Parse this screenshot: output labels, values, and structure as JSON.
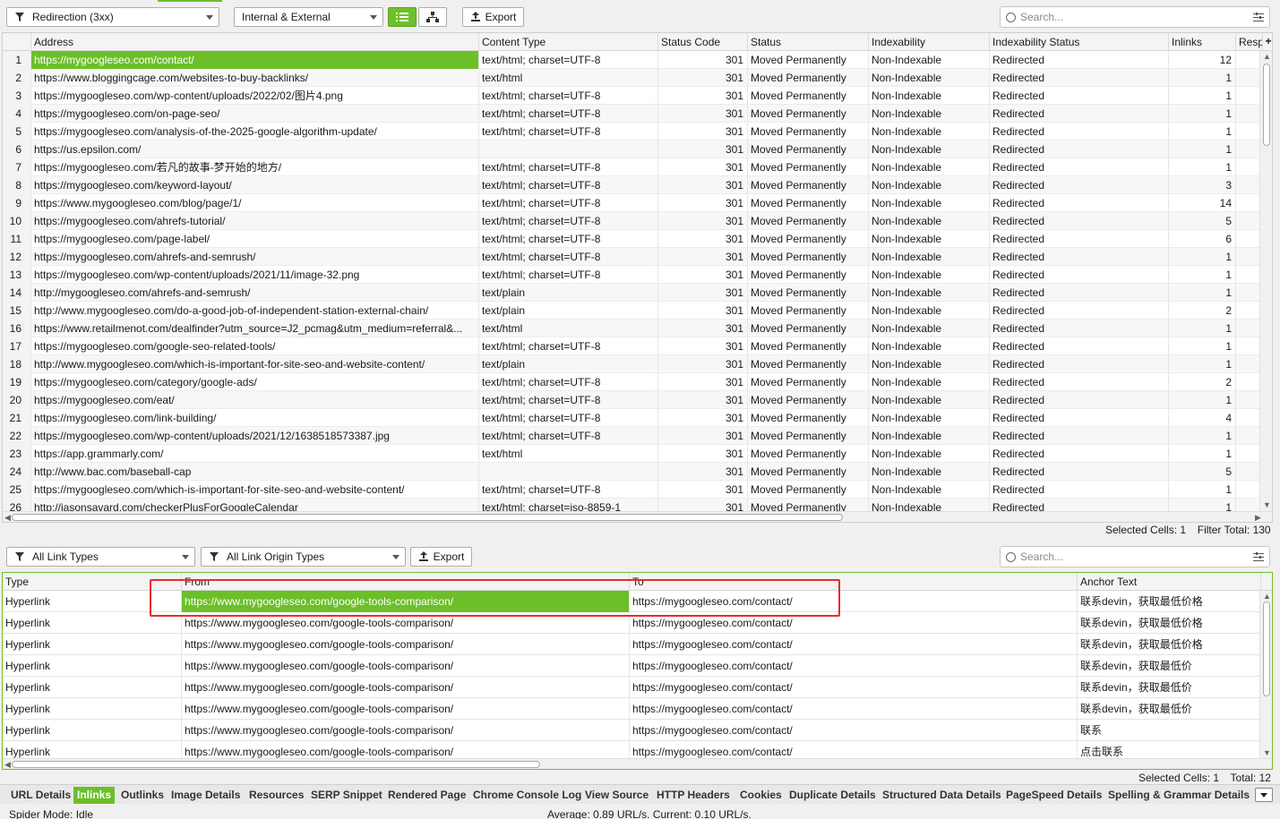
{
  "top_toolbar": {
    "filter": "Redirection (3xx)",
    "scope": "Internal & External",
    "export": "Export",
    "search_placeholder": "Search..."
  },
  "main_grid": {
    "columns": [
      "Address",
      "Content Type",
      "Status Code",
      "Status",
      "Indexability",
      "Indexability Status",
      "Inlinks",
      "Resp"
    ],
    "rows": [
      [
        "1",
        "https://mygoogleseo.com/contact/",
        "text/html; charset=UTF-8",
        "301",
        "Moved Permanently",
        "Non-Indexable",
        "Redirected",
        "12"
      ],
      [
        "2",
        "https://www.bloggingcage.com/websites-to-buy-backlinks/",
        "text/html",
        "301",
        "Moved Permanently",
        "Non-Indexable",
        "Redirected",
        "1"
      ],
      [
        "3",
        "https://mygoogleseo.com/wp-content/uploads/2022/02/图片4.png",
        "text/html; charset=UTF-8",
        "301",
        "Moved Permanently",
        "Non-Indexable",
        "Redirected",
        "1"
      ],
      [
        "4",
        "https://mygoogleseo.com/on-page-seo/",
        "text/html; charset=UTF-8",
        "301",
        "Moved Permanently",
        "Non-Indexable",
        "Redirected",
        "1"
      ],
      [
        "5",
        "https://mygoogleseo.com/analysis-of-the-2025-google-algorithm-update/",
        "text/html; charset=UTF-8",
        "301",
        "Moved Permanently",
        "Non-Indexable",
        "Redirected",
        "1"
      ],
      [
        "6",
        "https://us.epsilon.com/",
        "",
        "301",
        "Moved Permanently",
        "Non-Indexable",
        "Redirected",
        "1"
      ],
      [
        "7",
        "https://mygoogleseo.com/若凡的故事-梦开始的地方/",
        "text/html; charset=UTF-8",
        "301",
        "Moved Permanently",
        "Non-Indexable",
        "Redirected",
        "1"
      ],
      [
        "8",
        "https://mygoogleseo.com/keyword-layout/",
        "text/html; charset=UTF-8",
        "301",
        "Moved Permanently",
        "Non-Indexable",
        "Redirected",
        "3"
      ],
      [
        "9",
        "https://www.mygoogleseo.com/blog/page/1/",
        "text/html; charset=UTF-8",
        "301",
        "Moved Permanently",
        "Non-Indexable",
        "Redirected",
        "14"
      ],
      [
        "10",
        "https://mygoogleseo.com/ahrefs-tutorial/",
        "text/html; charset=UTF-8",
        "301",
        "Moved Permanently",
        "Non-Indexable",
        "Redirected",
        "5"
      ],
      [
        "11",
        "https://mygoogleseo.com/page-label/",
        "text/html; charset=UTF-8",
        "301",
        "Moved Permanently",
        "Non-Indexable",
        "Redirected",
        "6"
      ],
      [
        "12",
        "https://mygoogleseo.com/ahrefs-and-semrush/",
        "text/html; charset=UTF-8",
        "301",
        "Moved Permanently",
        "Non-Indexable",
        "Redirected",
        "1"
      ],
      [
        "13",
        "https://mygoogleseo.com/wp-content/uploads/2021/11/image-32.png",
        "text/html; charset=UTF-8",
        "301",
        "Moved Permanently",
        "Non-Indexable",
        "Redirected",
        "1"
      ],
      [
        "14",
        "http://mygoogleseo.com/ahrefs-and-semrush/",
        "text/plain",
        "301",
        "Moved Permanently",
        "Non-Indexable",
        "Redirected",
        "1"
      ],
      [
        "15",
        "http://www.mygoogleseo.com/do-a-good-job-of-independent-station-external-chain/",
        "text/plain",
        "301",
        "Moved Permanently",
        "Non-Indexable",
        "Redirected",
        "2"
      ],
      [
        "16",
        "https://www.retailmenot.com/dealfinder?utm_source=J2_pcmag&utm_medium=referral&...",
        "text/html",
        "301",
        "Moved Permanently",
        "Non-Indexable",
        "Redirected",
        "1"
      ],
      [
        "17",
        "https://mygoogleseo.com/google-seo-related-tools/",
        "text/html; charset=UTF-8",
        "301",
        "Moved Permanently",
        "Non-Indexable",
        "Redirected",
        "1"
      ],
      [
        "18",
        "http://www.mygoogleseo.com/which-is-important-for-site-seo-and-website-content/",
        "text/plain",
        "301",
        "Moved Permanently",
        "Non-Indexable",
        "Redirected",
        "1"
      ],
      [
        "19",
        "https://mygoogleseo.com/category/google-ads/",
        "text/html; charset=UTF-8",
        "301",
        "Moved Permanently",
        "Non-Indexable",
        "Redirected",
        "2"
      ],
      [
        "20",
        "https://mygoogleseo.com/eat/",
        "text/html; charset=UTF-8",
        "301",
        "Moved Permanently",
        "Non-Indexable",
        "Redirected",
        "1"
      ],
      [
        "21",
        "https://mygoogleseo.com/link-building/",
        "text/html; charset=UTF-8",
        "301",
        "Moved Permanently",
        "Non-Indexable",
        "Redirected",
        "4"
      ],
      [
        "22",
        "https://mygoogleseo.com/wp-content/uploads/2021/12/1638518573387.jpg",
        "text/html; charset=UTF-8",
        "301",
        "Moved Permanently",
        "Non-Indexable",
        "Redirected",
        "1"
      ],
      [
        "23",
        "https://app.grammarly.com/",
        "text/html",
        "301",
        "Moved Permanently",
        "Non-Indexable",
        "Redirected",
        "1"
      ],
      [
        "24",
        "http://www.bac.com/baseball-cap",
        "",
        "301",
        "Moved Permanently",
        "Non-Indexable",
        "Redirected",
        "5"
      ],
      [
        "25",
        "https://mygoogleseo.com/which-is-important-for-site-seo-and-website-content/",
        "text/html; charset=UTF-8",
        "301",
        "Moved Permanently",
        "Non-Indexable",
        "Redirected",
        "1"
      ],
      [
        "26",
        "http://jasonsavard.com/checkerPlusForGoogleCalendar",
        "text/html; charset=iso-8859-1",
        "301",
        "Moved Permanently",
        "Non-Indexable",
        "Redirected",
        "1"
      ]
    ],
    "status": {
      "selected_label": "Selected Cells:",
      "selected_value": "1",
      "filter_label": "Filter Total:",
      "filter_value": "130"
    }
  },
  "lower_toolbar": {
    "link_types": "All Link Types",
    "origin_types": "All Link Origin Types",
    "export": "Export",
    "search_placeholder": "Search..."
  },
  "lower_grid": {
    "columns": [
      "Type",
      "From",
      "To",
      "Anchor Text"
    ],
    "rows": [
      [
        "Hyperlink",
        "https://www.mygoogleseo.com/google-tools-comparison/",
        "https://mygoogleseo.com/contact/",
        "联系devin，获取最低价格"
      ],
      [
        "Hyperlink",
        "https://www.mygoogleseo.com/google-tools-comparison/",
        "https://mygoogleseo.com/contact/",
        "联系devin，获取最低价格"
      ],
      [
        "Hyperlink",
        "https://www.mygoogleseo.com/google-tools-comparison/",
        "https://mygoogleseo.com/contact/",
        "联系devin，获取最低价格"
      ],
      [
        "Hyperlink",
        "https://www.mygoogleseo.com/google-tools-comparison/",
        "https://mygoogleseo.com/contact/",
        "联系devin，获取最低价"
      ],
      [
        "Hyperlink",
        "https://www.mygoogleseo.com/google-tools-comparison/",
        "https://mygoogleseo.com/contact/",
        "联系devin，获取最低价"
      ],
      [
        "Hyperlink",
        "https://www.mygoogleseo.com/google-tools-comparison/",
        "https://mygoogleseo.com/contact/",
        "联系devin，获取最低价"
      ],
      [
        "Hyperlink",
        "https://www.mygoogleseo.com/google-tools-comparison/",
        "https://mygoogleseo.com/contact/",
        "联系"
      ],
      [
        "Hyperlink",
        "https://www.mygoogleseo.com/google-tools-comparison/",
        "https://mygoogleseo.com/contact/",
        "点击联系"
      ]
    ],
    "status": {
      "selected_label": "Selected Cells:",
      "selected_value": "1",
      "total_label": "Total:",
      "total_value": "12"
    }
  },
  "bottom_tabs": [
    "URL Details",
    "Inlinks",
    "Outlinks",
    "Image Details",
    "Resources",
    "SERP Snippet",
    "Rendered Page",
    "Chrome Console Log",
    "View Source",
    "HTTP Headers",
    "Cookies",
    "Duplicate Details",
    "Structured Data Details",
    "PageSpeed Details",
    "Spelling & Grammar Details"
  ],
  "active_tab": "Inlinks",
  "footer": {
    "mode": "Spider Mode: Idle",
    "speed": "Average: 0.89 URL/s. Current: 0.10 URL/s."
  },
  "colors": {
    "accent": "#6cbf29",
    "annotation": "#ea2b2b"
  }
}
